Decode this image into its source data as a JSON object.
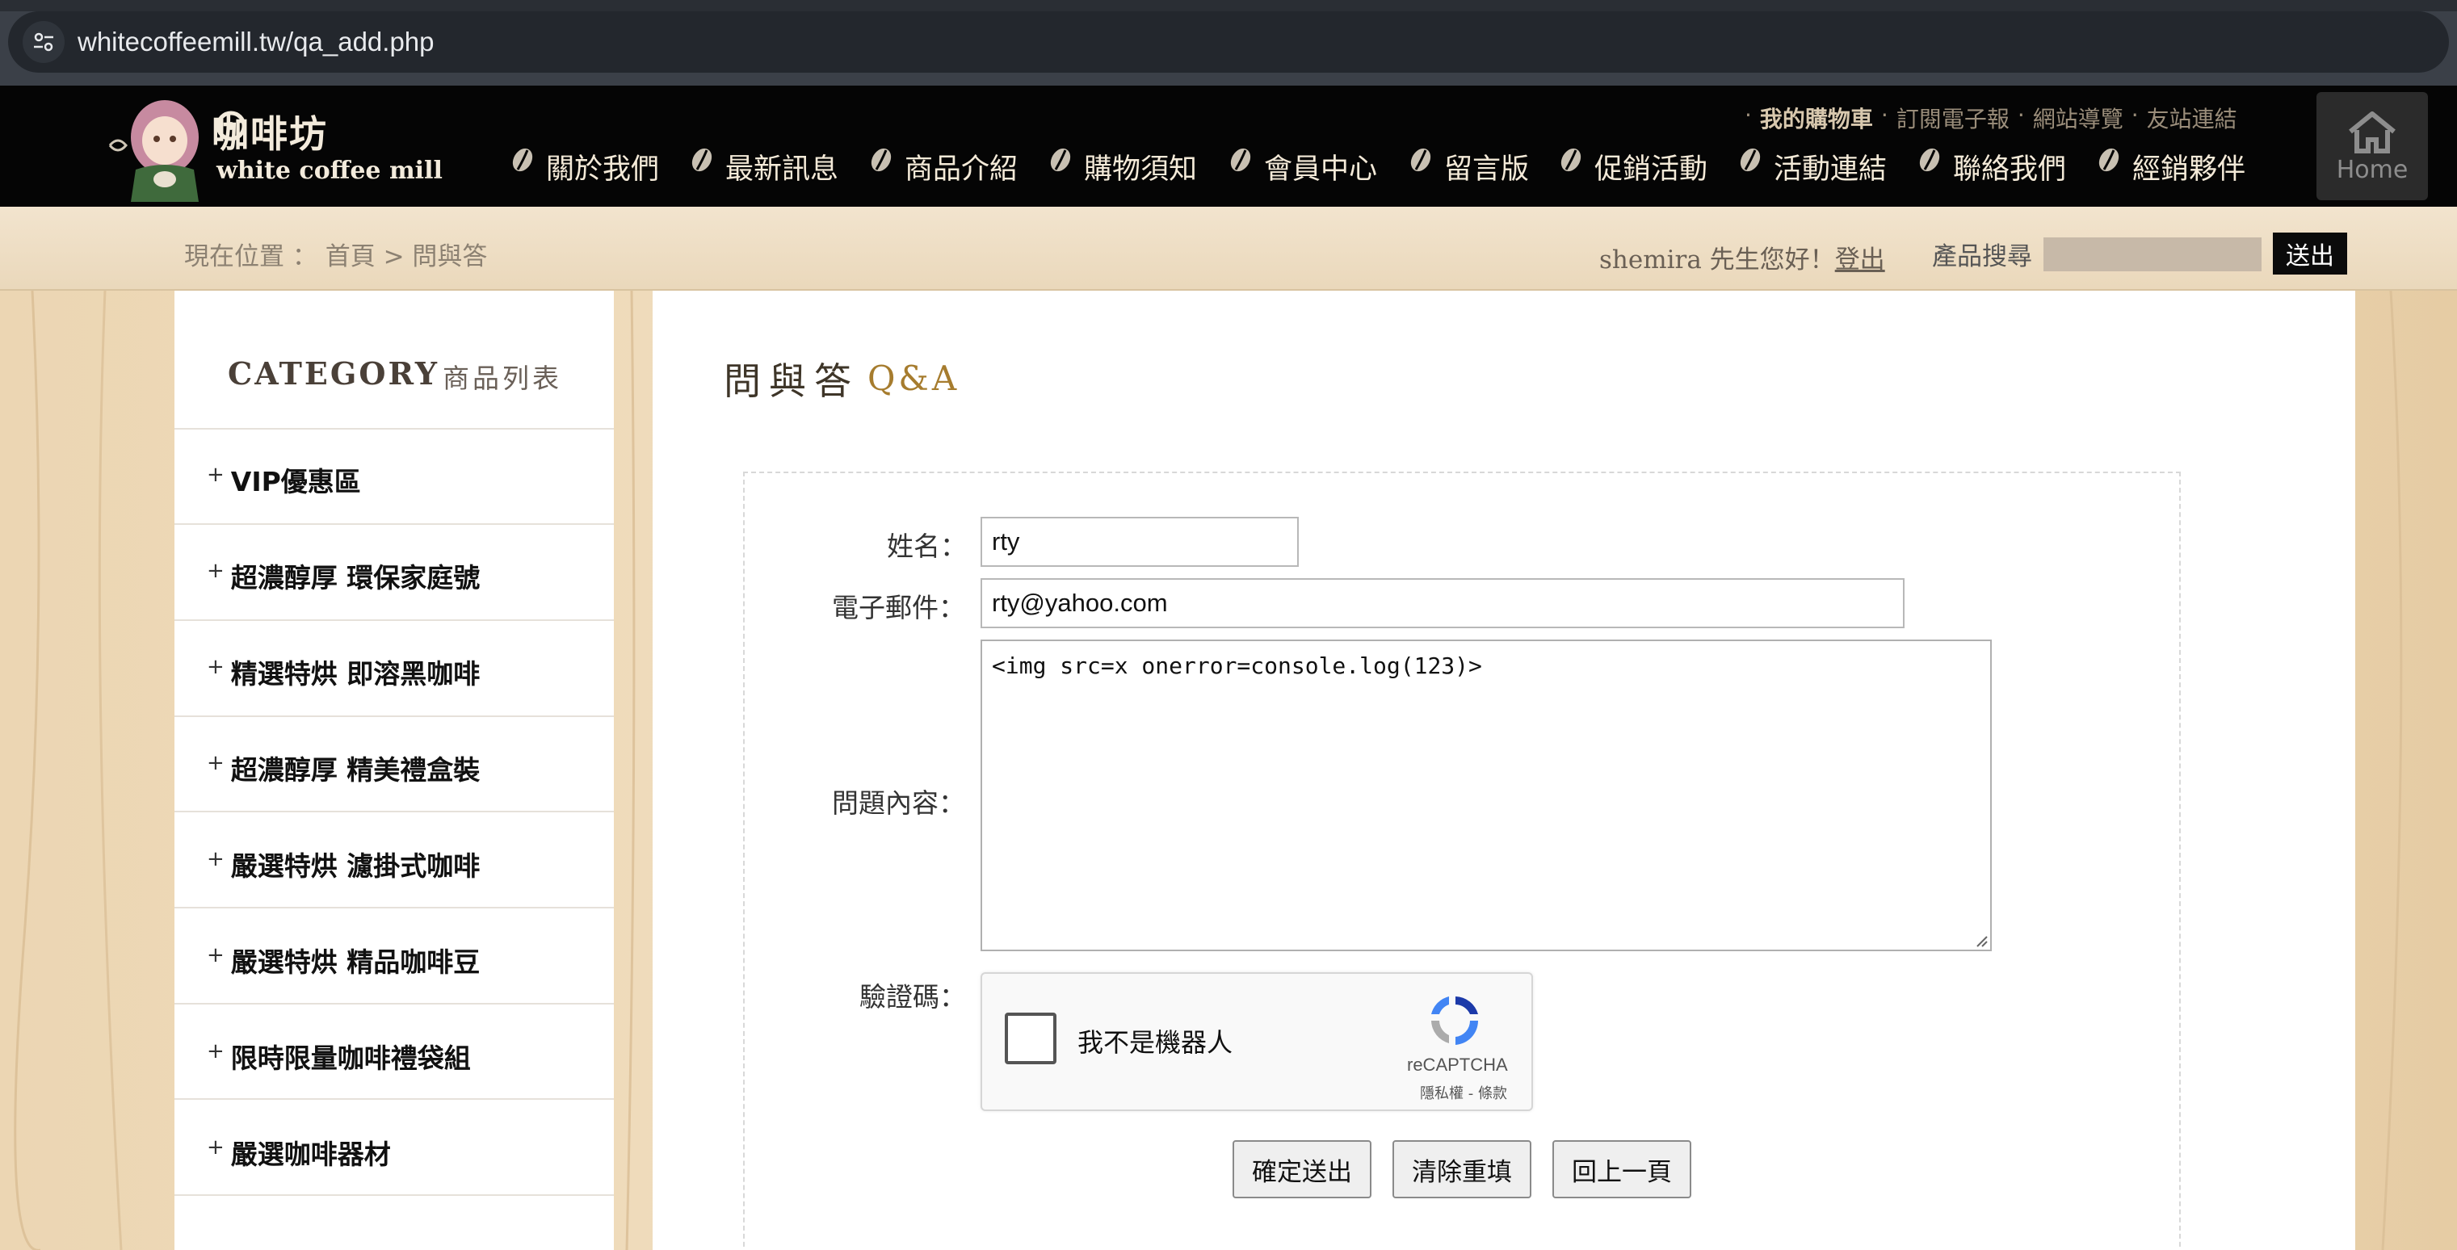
{
  "browser": {
    "url": "whitecoffeemill.tw/qa_add.php",
    "site_info_icon": "tune-icon"
  },
  "header": {
    "logo_text_cn": "咖啡坊",
    "logo_text_en": "white coffee mill",
    "nav": [
      {
        "label": "關於我們",
        "icon": "coffee-bean-icon"
      },
      {
        "label": "最新訊息",
        "icon": "coffee-bean-icon"
      },
      {
        "label": "商品介紹",
        "icon": "coffee-bean-icon"
      },
      {
        "label": "購物須知",
        "icon": "coffee-bean-icon"
      },
      {
        "label": "會員中心",
        "icon": "coffee-bean-icon"
      },
      {
        "label": "留言版",
        "icon": "coffee-bean-icon"
      },
      {
        "label": "促銷活動",
        "icon": "coffee-bean-icon"
      },
      {
        "label": "活動連結",
        "icon": "coffee-bean-icon"
      },
      {
        "label": "聯絡我們",
        "icon": "coffee-bean-icon"
      },
      {
        "label": "經銷夥伴",
        "icon": "coffee-bean-icon"
      }
    ],
    "top_links": {
      "cart": "我的購物車",
      "newsletter": "訂閱電子報",
      "sitemap": "網站導覽",
      "friends": "友站連結",
      "separator": "·"
    },
    "home_label": "Home"
  },
  "crumbbar": {
    "location_label": "現在位置 ：",
    "home": "首頁",
    "sep": ">",
    "current": "問與答",
    "greeting": "shemira 先生您好！",
    "logout": "登出",
    "search_label": "產品搜尋",
    "search_value": "",
    "search_button": "送出"
  },
  "sidebar": {
    "title": "CATEGORY",
    "subtitle": "商品列表",
    "plus": "+",
    "items": [
      "VIP優惠區",
      "超濃醇厚 環保家庭號",
      "精選特烘 即溶黑咖啡",
      "超濃醇厚 精美禮盒裝",
      "嚴選特烘 濾掛式咖啡",
      "嚴選特烘 精品咖啡豆",
      "限時限量咖啡禮袋組",
      "嚴選咖啡器材"
    ]
  },
  "main": {
    "title": "問與答",
    "subtitle": "Q&A",
    "form": {
      "name_label": "姓名：",
      "name_value": "rty",
      "email_label": "電子郵件：",
      "email_value": "rty@yahoo.com",
      "question_label": "問題內容：",
      "question_value": "<img src=x onerror=console.log(123)>",
      "captcha_label": "驗證碼：",
      "captcha_text": "我不是機器人",
      "captcha_brand": "reCAPTCHA",
      "captcha_links": "隱私權 - 條款",
      "submit": "確定送出",
      "reset": "清除重填",
      "back": "回上一頁"
    }
  }
}
